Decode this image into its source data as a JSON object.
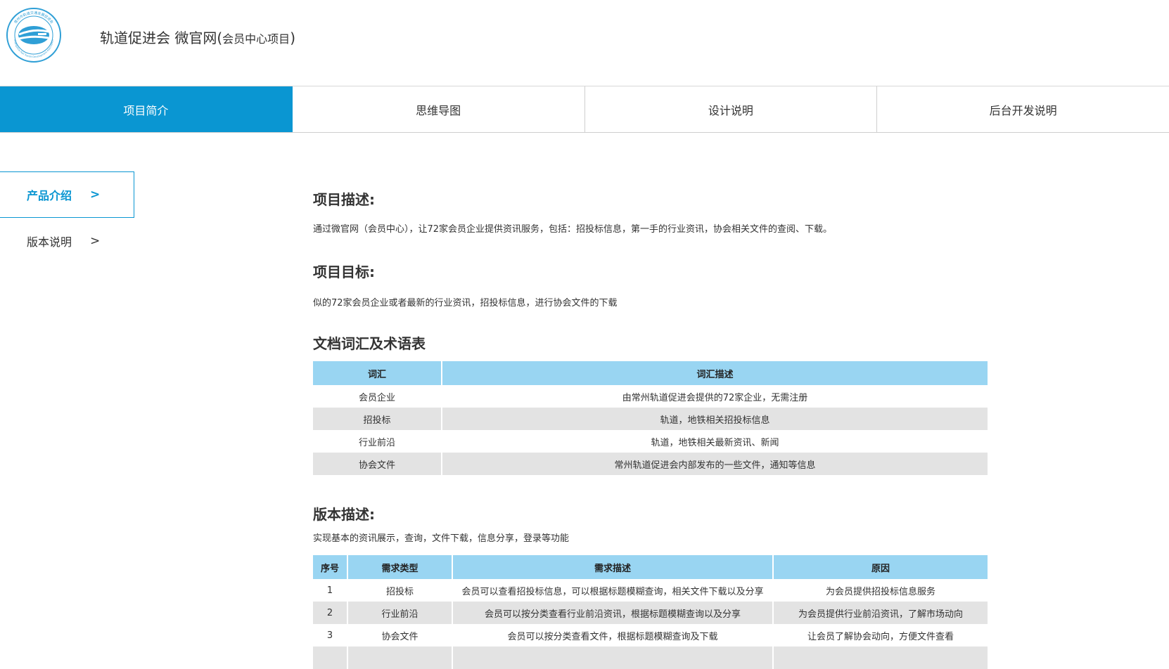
{
  "header": {
    "logo_ring_text": "常州市轨道交通发展促进会",
    "logo_ring_text_en": "Changzhou Rail Transit Development Association",
    "title_main": "轨道促进会  微官网(",
    "title_small": "会员中心项目",
    "title_end": ")"
  },
  "nav": {
    "tabs": [
      {
        "label": "项目简介"
      },
      {
        "label": "思维导图"
      },
      {
        "label": "设计说明"
      },
      {
        "label": "后台开发说明"
      }
    ]
  },
  "sidebar": {
    "items": [
      {
        "label": "产品介绍",
        "chevron": ">"
      },
      {
        "label": "版本说明",
        "chevron": ">"
      }
    ]
  },
  "content": {
    "desc_heading": "项目描述:",
    "desc_text": "通过微官网（会员中心），让72家会员企业提供资讯服务，包括：招投标信息，第一手的行业资讯，协会相关文件的查阅、下载。",
    "goal_heading": "项目目标:",
    "goal_text": "似的72家会员企业或者最新的行业资讯，招投标信息，进行协会文件的下载",
    "glossary_heading": "文档词汇及术语表",
    "glossary": {
      "headers": [
        "词汇",
        "词汇描述"
      ],
      "rows": [
        [
          "会员企业",
          "由常州轨道促进会提供的72家企业，无需注册"
        ],
        [
          "招投标",
          "轨道，地铁相关招投标信息"
        ],
        [
          "行业前沿",
          "轨道，地铁相关最新资讯、新闻"
        ],
        [
          "协会文件",
          "常州轨道促进会内部发布的一些文件，通知等信息"
        ]
      ]
    },
    "version_heading": "版本描述:",
    "version_text": "实现基本的资讯展示，查询，文件下载，信息分享，登录等功能",
    "requirements": {
      "headers": [
        "序号",
        "需求类型",
        "需求描述",
        "原因"
      ],
      "rows": [
        [
          "1",
          "招投标",
          "会员可以查看招投标信息，可以根据标题模糊查询，相关文件下载以及分享",
          "为会员提供招投标信息服务"
        ],
        [
          "2",
          "行业前沿",
          "会员可以按分类查看行业前沿资讯，根据标题模糊查询以及分享",
          "为会员提供行业前沿资讯，了解市场动向"
        ],
        [
          "3",
          "协会文件",
          "会员可以按分类查看文件，根据标题模糊查询及下载",
          "让会员了解协会动向，方便文件查看"
        ]
      ]
    }
  },
  "colors": {
    "accent": "#0a96d2",
    "table_header": "#99d5f2",
    "row_alt": "#e3e3e3"
  }
}
